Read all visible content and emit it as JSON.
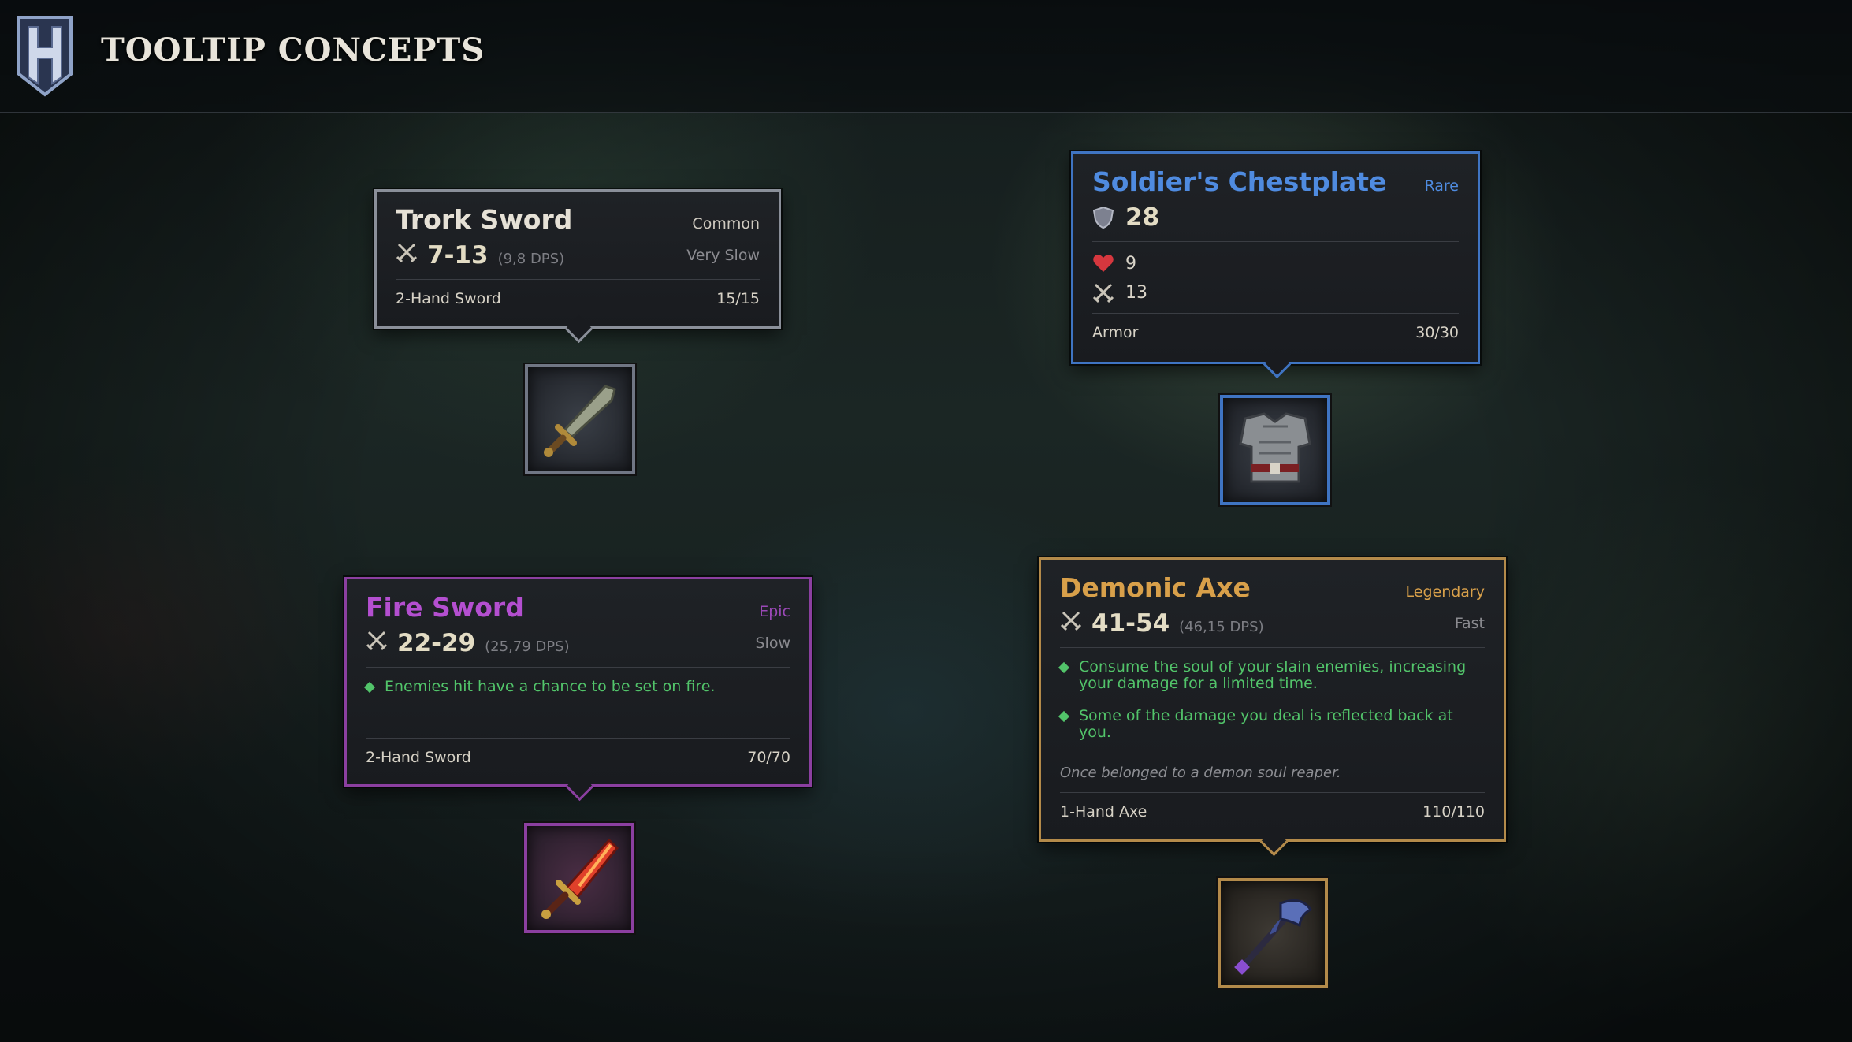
{
  "header": {
    "title": "TOOLTIP CONCEPTS"
  },
  "colors": {
    "common": "#8a8f99",
    "rare": "#3f74c2",
    "epic": "#8b3fa0",
    "legendary": "#b38a4a",
    "effect_green": "#52c46a"
  },
  "items": {
    "trork_sword": {
      "name": "Trork Sword",
      "rarity": "Common",
      "damage": "7-13",
      "dps": "(9,8 DPS)",
      "speed": "Very Slow",
      "type": "2-Hand Sword",
      "durability": "15/15",
      "icon": "sword-icon"
    },
    "soldiers_chestplate": {
      "name": "Soldier's Chestplate",
      "rarity": "Rare",
      "armor": "28",
      "health": "9",
      "attack": "13",
      "type": "Armor",
      "durability": "30/30",
      "icon": "chestplate-icon"
    },
    "fire_sword": {
      "name": "Fire Sword",
      "rarity": "Epic",
      "damage": "22-29",
      "dps": "(25,79 DPS)",
      "speed": "Slow",
      "effects": [
        "Enemies hit have a chance to be set on fire."
      ],
      "type": "2-Hand Sword",
      "durability": "70/70",
      "icon": "fire-sword-icon"
    },
    "demonic_axe": {
      "name": "Demonic Axe",
      "rarity": "Legendary",
      "damage": "41-54",
      "dps": "(46,15 DPS)",
      "speed": "Fast",
      "effects": [
        "Consume the soul of your slain enemies, increasing your damage for a limited time.",
        "Some of the damage you deal is reflected back at you."
      ],
      "lore": "Once belonged to a demon soul reaper.",
      "type": "1-Hand Axe",
      "durability": "110/110",
      "icon": "axe-icon"
    }
  }
}
